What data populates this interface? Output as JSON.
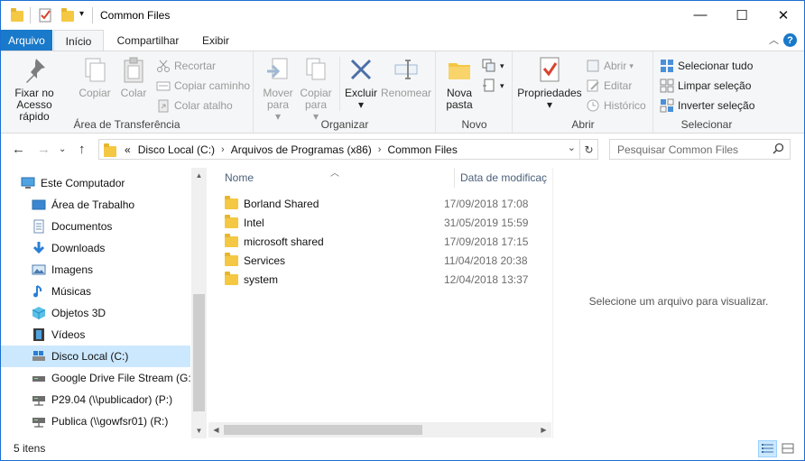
{
  "window": {
    "title": "Common Files",
    "minimize_glyph": "—",
    "maximize_glyph": "☐",
    "close_glyph": "✕"
  },
  "tabs": {
    "file": "Arquivo",
    "home": "Início",
    "share": "Compartilhar",
    "view": "Exibir"
  },
  "ribbon": {
    "clipboard": {
      "label": "Área de Transferência",
      "pin": "Fixar no Acesso rápido",
      "copy": "Copiar",
      "paste": "Colar",
      "cut": "Recortar",
      "copy_path": "Copiar caminho",
      "paste_shortcut": "Colar atalho"
    },
    "organize": {
      "label": "Organizar",
      "move_to": "Mover para",
      "copy_to": "Copiar para",
      "delete": "Excluir",
      "rename": "Renomear"
    },
    "new": {
      "label": "Novo",
      "new_folder": "Nova pasta"
    },
    "open": {
      "label": "Abrir",
      "properties": "Propriedades",
      "open": "Abrir",
      "edit": "Editar",
      "history": "Histórico"
    },
    "select": {
      "label": "Selecionar",
      "select_all": "Selecionar tudo",
      "select_none": "Limpar seleção",
      "invert": "Inverter seleção"
    }
  },
  "address": {
    "overflow": "«",
    "crumbs": [
      "Disco Local (C:)",
      "Arquivos de Programas (x86)",
      "Common Files"
    ],
    "search_placeholder": "Pesquisar Common Files"
  },
  "nav": {
    "items": [
      {
        "label": "Este Computador",
        "icon": "computer-icon"
      },
      {
        "label": "Área de Trabalho",
        "icon": "desktop-icon"
      },
      {
        "label": "Documentos",
        "icon": "documents-icon"
      },
      {
        "label": "Downloads",
        "icon": "downloads-icon"
      },
      {
        "label": "Imagens",
        "icon": "pictures-icon"
      },
      {
        "label": "Músicas",
        "icon": "music-icon"
      },
      {
        "label": "Objetos 3D",
        "icon": "objects3d-icon"
      },
      {
        "label": "Vídeos",
        "icon": "videos-icon"
      },
      {
        "label": "Disco Local (C:)",
        "icon": "local-disk-icon",
        "selected": true
      },
      {
        "label": "Google Drive File Stream (G:)",
        "icon": "drive-icon"
      },
      {
        "label": "P29.04 (\\\\publicador) (P:)",
        "icon": "network-drive-icon"
      },
      {
        "label": "Publica (\\\\gowfsr01) (R:)",
        "icon": "network-drive-icon"
      }
    ]
  },
  "files": {
    "col_name": "Nome",
    "col_date": "Data de modificaç",
    "rows": [
      {
        "name": "Borland Shared",
        "date": "17/09/2018 17:08"
      },
      {
        "name": "Intel",
        "date": "31/05/2019 15:59"
      },
      {
        "name": "microsoft shared",
        "date": "17/09/2018 17:15"
      },
      {
        "name": "Services",
        "date": "11/04/2018 20:38"
      },
      {
        "name": "system",
        "date": "12/04/2018 13:37"
      }
    ]
  },
  "preview": {
    "text": "Selecione um arquivo para visualizar."
  },
  "status": {
    "count": "5 itens"
  },
  "colors": {
    "accent": "#1979ca",
    "folder": "#f4c842",
    "selection": "#cce8ff"
  }
}
